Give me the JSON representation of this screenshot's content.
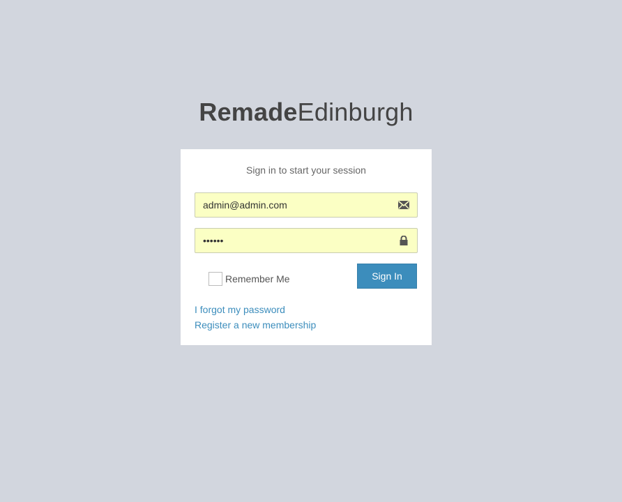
{
  "logo": {
    "bold": "Remade",
    "light": "Edinburgh"
  },
  "login": {
    "message": "Sign in to start your session",
    "email": {
      "value": "admin@admin.com",
      "icon": "envelope-icon"
    },
    "password": {
      "value": "••••••",
      "icon": "lock-icon"
    },
    "remember_label": "Remember Me",
    "signin_label": "Sign In",
    "forgot_link": "I forgot my password",
    "register_link": "Register a new membership"
  },
  "colors": {
    "background": "#d2d6de",
    "accent": "#3c8dbc",
    "autofill": "#fbffc4"
  }
}
